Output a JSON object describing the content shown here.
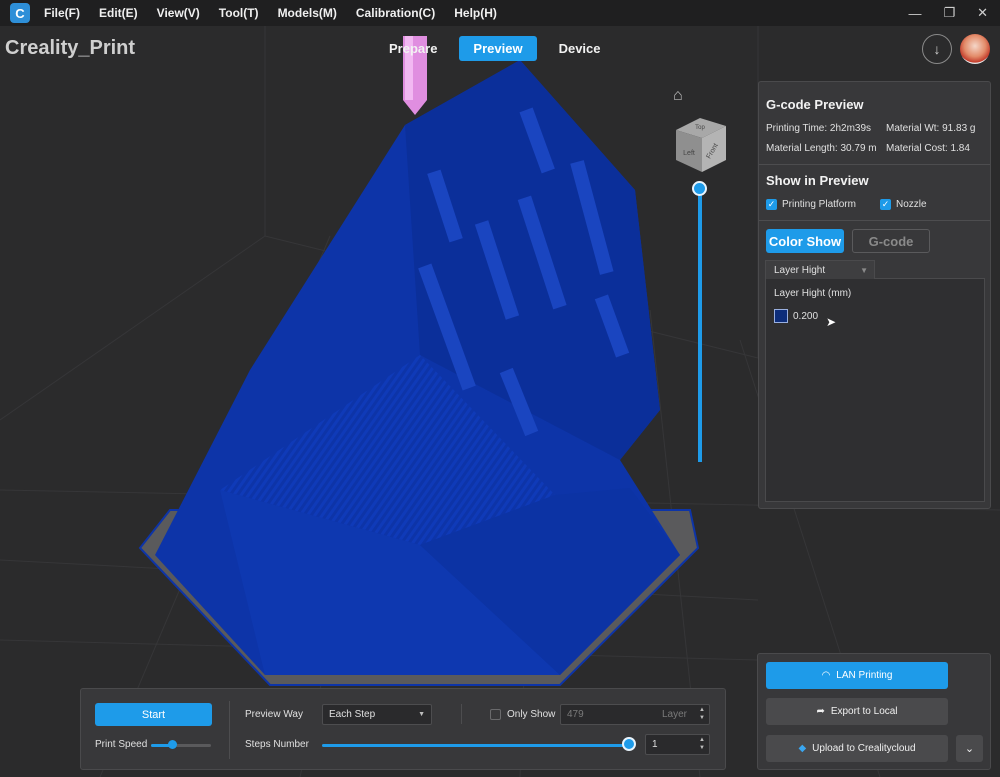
{
  "menu": {
    "items": [
      "File(F)",
      "Edit(E)",
      "View(V)",
      "Tool(T)",
      "Models(M)",
      "Calibration(C)",
      "Help(H)"
    ]
  },
  "window_controls": [
    "minimize-icon",
    "restore-icon",
    "close-icon"
  ],
  "app_title": "Creality_Print",
  "tabs": [
    {
      "label": "Prepare",
      "active": false
    },
    {
      "label": "Preview",
      "active": true
    },
    {
      "label": "Device",
      "active": false
    }
  ],
  "view_cube": {
    "faces": [
      "Left",
      "Front",
      "Top"
    ]
  },
  "gcode_panel": {
    "title": "G-code Preview",
    "printing_time": "Printing Time: 2h2m39s",
    "material_wt": "Material Wt: 91.83 g",
    "material_length": "Material Length: 30.79 m",
    "material_cost": "Material Cost: 1.84",
    "show_title": "Show in Preview",
    "printing_platform": "Printing Platform",
    "nozzle": "Nozzle",
    "color_show": "Color Show",
    "gcode": "G-code",
    "select_value": "Layer Hight",
    "legend_title": "Layer Hight (mm)",
    "legend_value": "0.200",
    "legend_color": "#0d2d7a"
  },
  "bottom_panel": {
    "start": "Start",
    "print_speed": "Print Speed",
    "print_speed_level": 0.5,
    "preview_way_label": "Preview Way",
    "preview_way_value": "Each Step",
    "only_show": "Only Show",
    "layer_value": "479",
    "layer_unit": "Layer",
    "steps_number_label": "Steps Number",
    "steps_value": "1"
  },
  "output_panel": {
    "lan_printing": "LAN Printing",
    "export_local": "Export to Local",
    "upload": "Upload to Crealitycloud"
  },
  "colors": {
    "accent": "#1e9be9",
    "model": "#0d34a8",
    "background": "#2b2b2c"
  }
}
